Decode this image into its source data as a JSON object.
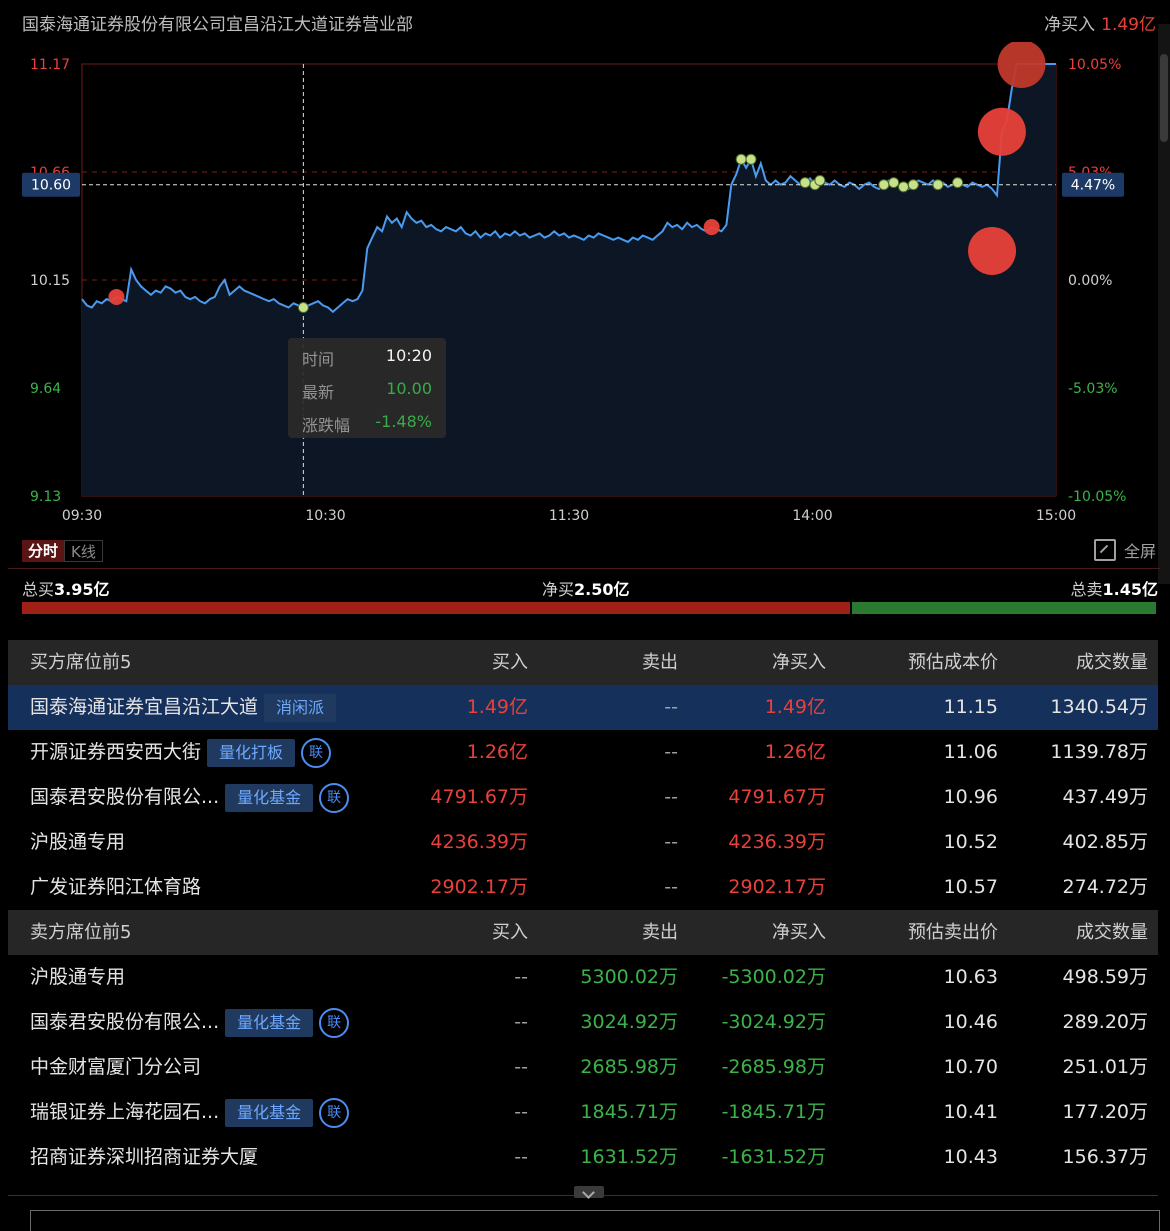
{
  "header": {
    "broker": "国泰海通证券股份有限公司宜昌沿江大道证券营业部",
    "net_buy_label": "净买入",
    "net_buy_value": "1.49亿"
  },
  "chart_data": {
    "type": "line",
    "y_ticks_left": [
      "11.17",
      "10.66",
      "10.15",
      "9.64",
      "9.13"
    ],
    "y_ticks_right": [
      "10.05%",
      "5.03%",
      "0.00%",
      "-5.03%",
      "-10.05%"
    ],
    "x_ticks": [
      "09:30",
      "10:30",
      "11:30",
      "14:00",
      "15:00"
    ],
    "ylim": [
      9.13,
      11.17
    ],
    "prev_close": 10.15,
    "crosshair_price": "10.60",
    "crosshair_pct": "4.47%",
    "crosshair_time": "10:20",
    "series": [
      {
        "values": [
          10.06,
          10.03,
          10.02,
          10.05,
          10.04,
          10.06,
          10.05,
          10.07,
          10.06,
          10.05,
          10.2,
          10.15,
          10.12,
          10.1,
          10.08,
          10.1,
          10.09,
          10.12,
          10.11,
          10.09,
          10.1,
          10.07,
          10.06,
          10.07,
          10.05,
          10.04,
          10.06,
          10.07,
          10.12,
          10.15,
          10.08,
          10.1,
          10.12,
          10.1,
          10.09,
          10.08,
          10.07,
          10.06,
          10.05,
          10.06,
          10.04,
          10.03,
          10.02,
          10.04,
          10.03,
          10.02,
          10.03,
          10.04,
          10.05,
          10.03,
          10.02,
          10.0,
          10.02,
          10.04,
          10.06,
          10.05,
          10.06,
          10.1,
          10.3,
          10.35,
          10.4,
          10.38,
          10.45,
          10.42,
          10.44,
          10.4,
          10.47,
          10.44,
          10.42,
          10.43,
          10.4,
          10.41,
          10.39,
          10.38,
          10.4,
          10.39,
          10.38,
          10.4,
          10.37,
          10.36,
          10.38,
          10.35,
          10.37,
          10.36,
          10.38,
          10.35,
          10.37,
          10.36,
          10.38,
          10.36,
          10.37,
          10.35,
          10.36,
          10.37,
          10.35,
          10.36,
          10.38,
          10.36,
          10.37,
          10.35,
          10.36,
          10.35,
          10.34,
          10.36,
          10.35,
          10.37,
          10.36,
          10.35,
          10.34,
          10.35,
          10.34,
          10.33,
          10.35,
          10.34,
          10.36,
          10.35,
          10.34,
          10.36,
          10.38,
          10.42,
          10.4,
          10.41,
          10.39,
          10.42,
          10.4,
          10.41,
          10.39,
          10.38,
          10.4,
          10.39,
          10.38,
          10.41,
          10.6,
          10.65,
          10.72,
          10.68,
          10.72,
          10.64,
          10.7,
          10.62,
          10.6,
          10.62,
          10.6,
          10.61,
          10.64,
          10.62,
          10.6,
          10.61,
          10.63,
          10.6,
          10.62,
          10.61,
          10.6,
          10.62,
          10.6,
          10.59,
          10.61,
          10.6,
          10.58,
          10.6,
          10.61,
          10.59,
          10.58,
          10.6,
          10.62,
          10.61,
          10.6,
          10.59,
          10.58,
          10.6,
          10.62,
          10.61,
          10.6,
          10.62,
          10.6,
          10.61,
          10.59,
          10.6,
          10.61,
          10.6,
          10.59,
          10.61,
          10.6,
          10.59,
          10.6,
          10.58,
          10.55,
          10.85,
          10.9,
          11.05,
          11.17,
          11.17,
          11.17,
          11.17,
          11.17,
          11.17,
          11.17,
          11.17,
          11.17
        ]
      }
    ],
    "markers_red": [
      {
        "index": 7
      },
      {
        "index": 128
      },
      {
        "index": 187
      },
      {
        "index": 185
      },
      {
        "index": 191
      }
    ],
    "markers_green": [
      {
        "index": 45
      },
      {
        "index": 134
      },
      {
        "index": 136
      },
      {
        "index": 147
      },
      {
        "index": 149
      },
      {
        "index": 150
      },
      {
        "index": 163
      },
      {
        "index": 165
      },
      {
        "index": 167
      },
      {
        "index": 169
      },
      {
        "index": 174
      },
      {
        "index": 178
      }
    ]
  },
  "tooltip": {
    "time_label": "时间",
    "time_value": "10:20",
    "price_label": "最新",
    "price_value": "10.00",
    "change_label": "涨跌幅",
    "change_value": "-1.48%"
  },
  "tabs": {
    "active": "分时",
    "inactive": "K线",
    "fullscreen": "全屏"
  },
  "summary": {
    "total_buy_label": "总买",
    "total_buy": "3.95亿",
    "net_buy_label": "净买",
    "net_buy": "2.50亿",
    "total_sell_label": "总卖",
    "total_sell": "1.45亿",
    "buy_ratio": 0.731
  },
  "buy_table": {
    "headers": [
      "买方席位前5",
      "买入",
      "卖出",
      "净买入",
      "预估成本价",
      "成交数量"
    ],
    "rows": [
      {
        "name": "国泰海通证券宜昌沿江大道",
        "badge": "消闲派",
        "lian": "",
        "buy": "1.49亿",
        "sell": "--",
        "net": "1.49亿",
        "price": "11.15",
        "vol": "1340.54万"
      },
      {
        "name": "开源证券西安西大街",
        "badge": "量化打板",
        "lian": "联",
        "buy": "1.26亿",
        "sell": "--",
        "net": "1.26亿",
        "price": "11.06",
        "vol": "1139.78万"
      },
      {
        "name": "国泰君安股份有限公...",
        "badge": "量化基金",
        "lian": "联",
        "buy": "4791.67万",
        "sell": "--",
        "net": "4791.67万",
        "price": "10.96",
        "vol": "437.49万"
      },
      {
        "name": "沪股通专用",
        "badge": "",
        "lian": "",
        "buy": "4236.39万",
        "sell": "--",
        "net": "4236.39万",
        "price": "10.52",
        "vol": "402.85万"
      },
      {
        "name": "广发证券阳江体育路",
        "badge": "",
        "lian": "",
        "buy": "2902.17万",
        "sell": "--",
        "net": "2902.17万",
        "price": "10.57",
        "vol": "274.72万"
      }
    ]
  },
  "sell_table": {
    "headers": [
      "卖方席位前5",
      "买入",
      "卖出",
      "净买入",
      "预估卖出价",
      "成交数量"
    ],
    "rows": [
      {
        "name": "沪股通专用",
        "badge": "",
        "lian": "",
        "buy": "--",
        "sell": "5300.02万",
        "net": "-5300.02万",
        "price": "10.63",
        "vol": "498.59万"
      },
      {
        "name": "国泰君安股份有限公...",
        "badge": "量化基金",
        "lian": "联",
        "buy": "--",
        "sell": "3024.92万",
        "net": "-3024.92万",
        "price": "10.46",
        "vol": "289.20万"
      },
      {
        "name": "中金财富厦门分公司",
        "badge": "",
        "lian": "",
        "buy": "--",
        "sell": "2685.98万",
        "net": "-2685.98万",
        "price": "10.70",
        "vol": "251.01万"
      },
      {
        "name": "瑞银证券上海花园石...",
        "badge": "量化基金",
        "lian": "联",
        "buy": "--",
        "sell": "1845.71万",
        "net": "-1845.71万",
        "price": "10.41",
        "vol": "177.20万"
      },
      {
        "name": "招商证券深圳招商证券大厦",
        "badge": "",
        "lian": "",
        "buy": "--",
        "sell": "1631.52万",
        "net": "-1631.52万",
        "price": "10.43",
        "vol": "156.37万"
      }
    ]
  },
  "colors": {
    "up": "#e8403a",
    "down": "#3bb34a",
    "line": "#4a9bef",
    "selected_row": "#16305c"
  }
}
